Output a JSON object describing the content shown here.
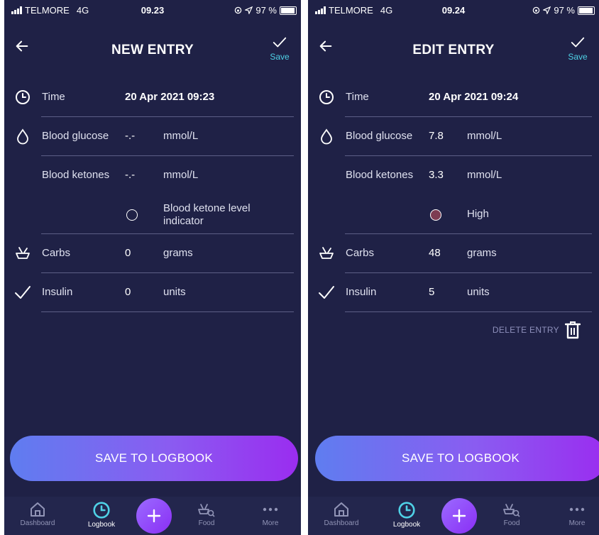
{
  "screens": [
    {
      "status": {
        "carrier": "TELMORE",
        "network": "4G",
        "time": "09.23",
        "battery": "97 %"
      },
      "title": "NEW ENTRY",
      "save_label": "Save",
      "rows": {
        "time": {
          "label": "Time",
          "value": "20 Apr 2021 09:23"
        },
        "glucose": {
          "label": "Blood glucose",
          "value": "-.-",
          "unit": "mmol/L"
        },
        "ketones": {
          "label": "Blood ketones",
          "value": "-.-",
          "unit": "mmol/L"
        },
        "indicator": {
          "text": "Blood ketone level indicator",
          "color": "#1f2146"
        },
        "carbs": {
          "label": "Carbs",
          "value": "0",
          "unit": "grams"
        },
        "insulin": {
          "label": "Insulin",
          "value": "0",
          "unit": "units"
        }
      },
      "save_button": "SAVE TO LOGBOOK"
    },
    {
      "status": {
        "carrier": "TELMORE",
        "network": "4G",
        "time": "09.24",
        "battery": "97 %"
      },
      "title": "EDIT ENTRY",
      "save_label": "Save",
      "rows": {
        "time": {
          "label": "Time",
          "value": "20 Apr 2021 09:24"
        },
        "glucose": {
          "label": "Blood glucose",
          "value": "7.8",
          "unit": "mmol/L"
        },
        "ketones": {
          "label": "Blood ketones",
          "value": "3.3",
          "unit": "mmol/L"
        },
        "indicator": {
          "text": "High",
          "color": "#7d3c52"
        },
        "carbs": {
          "label": "Carbs",
          "value": "48",
          "unit": "grams"
        },
        "insulin": {
          "label": "Insulin",
          "value": "5",
          "unit": "units"
        }
      },
      "delete_label": "DELETE ENTRY",
      "save_button": "SAVE TO LOGBOOK"
    }
  ],
  "tabs": [
    {
      "label": "Dashboard",
      "icon": "home-icon"
    },
    {
      "label": "Logbook",
      "icon": "clock-icon",
      "active": true
    },
    {
      "label": "",
      "icon": "plus-icon"
    },
    {
      "label": "Food",
      "icon": "food-icon"
    },
    {
      "label": "More",
      "icon": "more-icon"
    }
  ],
  "colors": {
    "background": "#1f2146",
    "accent": "#4fd1e6",
    "gradient_start": "#5f7df0",
    "gradient_end": "#9a2df0"
  }
}
